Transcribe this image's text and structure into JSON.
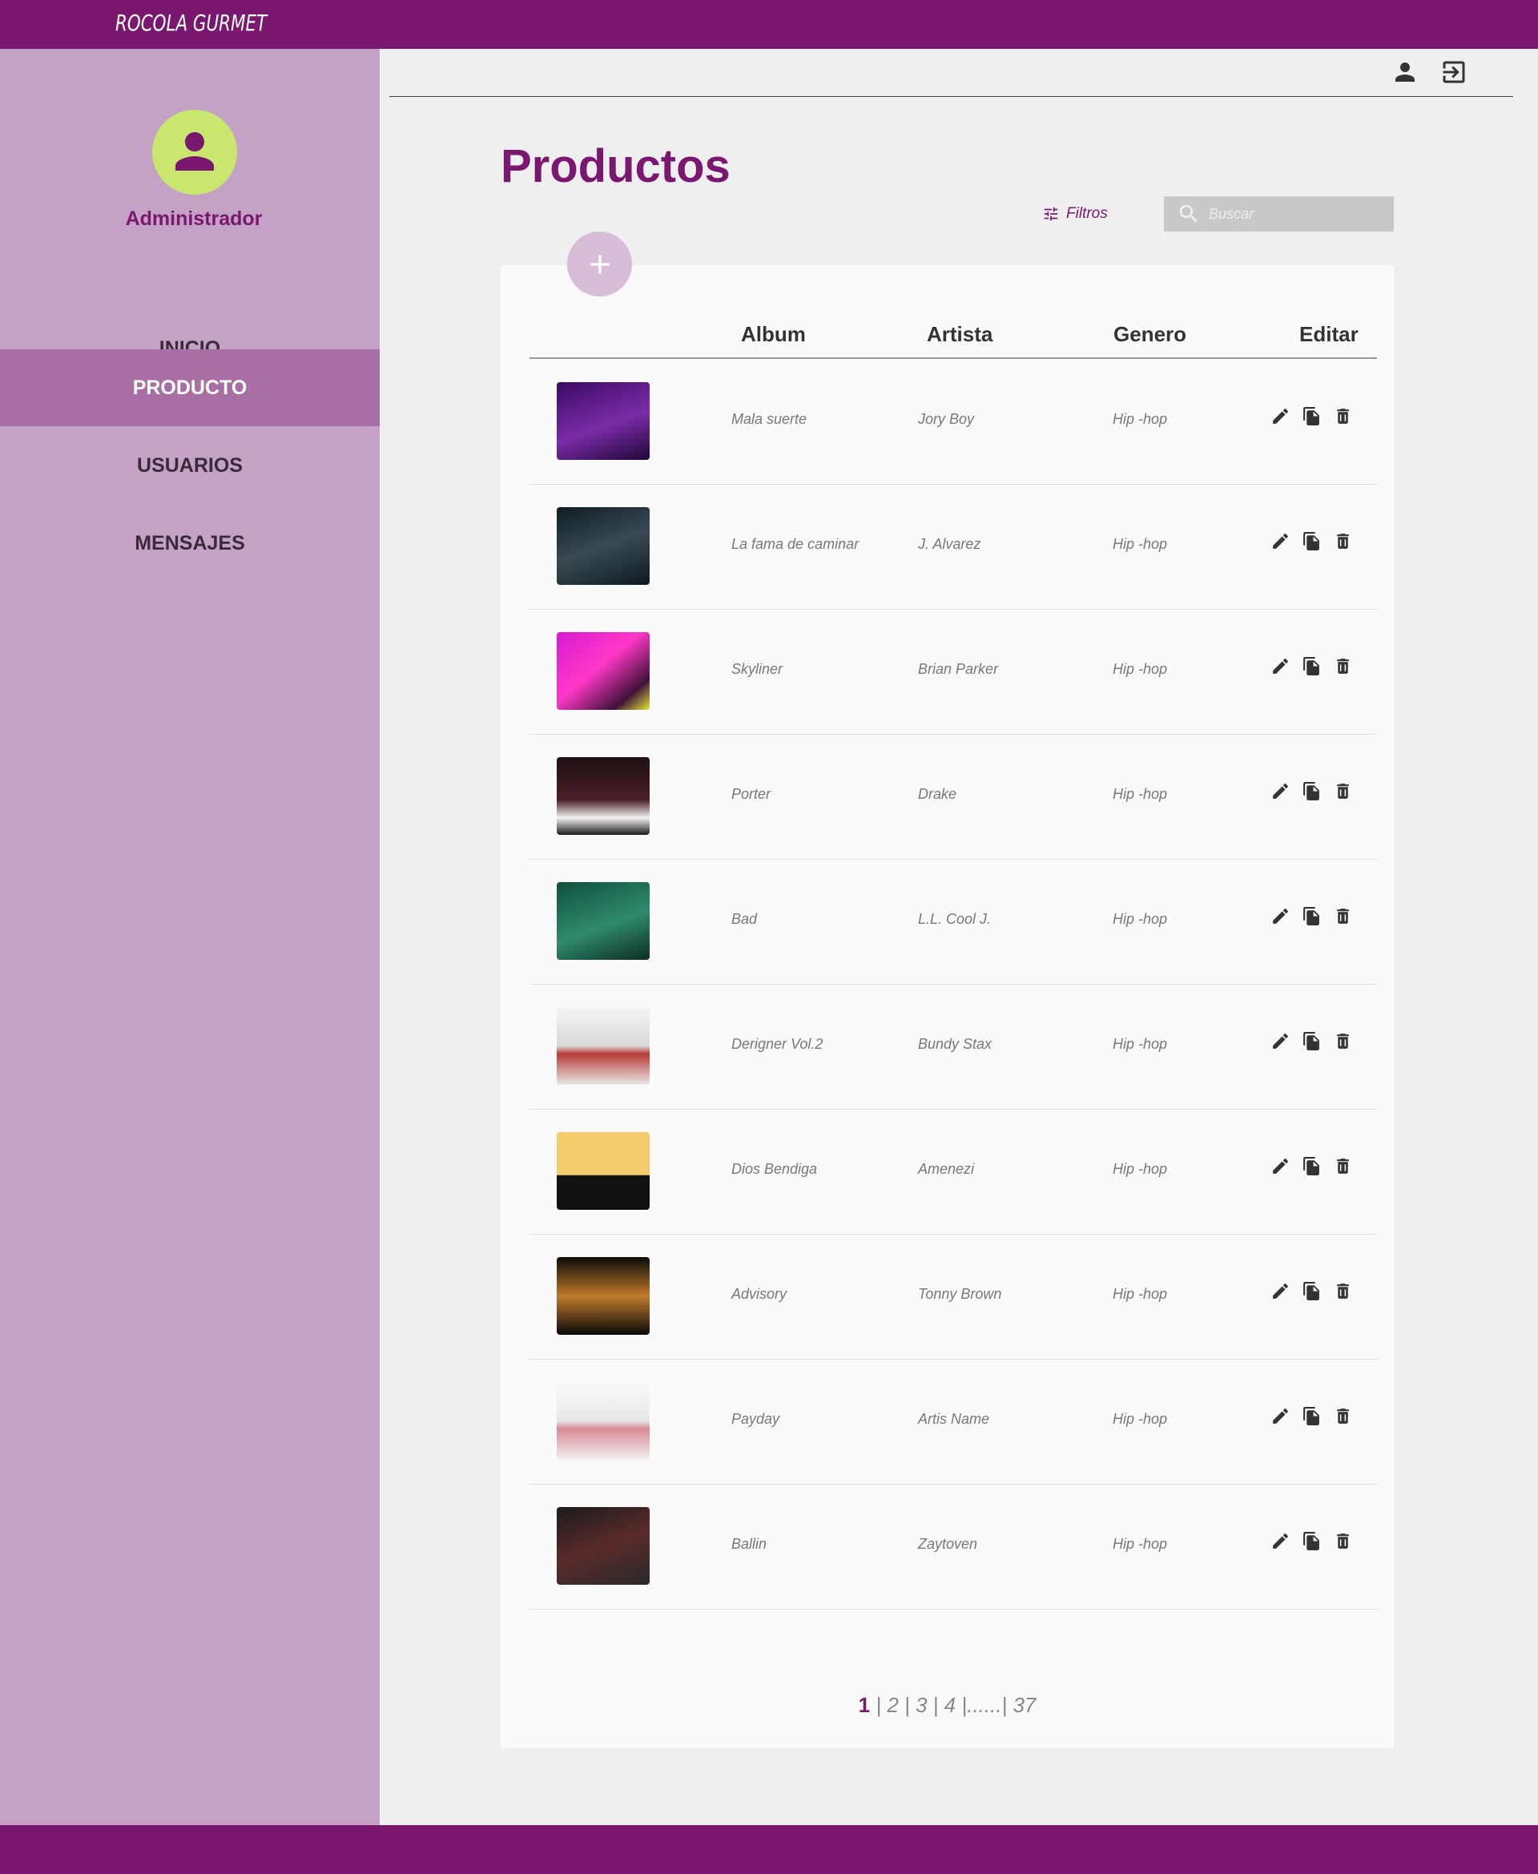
{
  "app": {
    "brand": "ROCOLA GURMET"
  },
  "sidebar": {
    "user_role": "Administrador",
    "items": [
      {
        "label": "INICIO",
        "active": false
      },
      {
        "label": "PRODUCTO",
        "active": true
      },
      {
        "label": "USUARIOS",
        "active": false
      },
      {
        "label": "MENSAJES",
        "active": false
      }
    ]
  },
  "header": {
    "icons": [
      "person-icon",
      "logout-icon"
    ]
  },
  "main": {
    "title": "Productos",
    "filters_label": "Filtros",
    "search": {
      "placeholder": "Buscar",
      "value": ""
    },
    "table": {
      "columns": [
        "Album",
        "Artista",
        "Genero",
        "Editar"
      ],
      "rows": [
        {
          "album": "Mala suerte",
          "artist": "Jory Boy",
          "genre": "Hip -hop"
        },
        {
          "album": "La fama de caminar",
          "artist": "J. Alvarez",
          "genre": "Hip -hop"
        },
        {
          "album": "Skyliner",
          "artist": "Brian Parker",
          "genre": "Hip -hop"
        },
        {
          "album": "Porter",
          "artist": "Drake",
          "genre": "Hip -hop"
        },
        {
          "album": "Bad",
          "artist": "L.L. Cool J.",
          "genre": "Hip -hop"
        },
        {
          "album": "Derigner Vol.2",
          "artist": "Bundy Stax",
          "genre": "Hip -hop"
        },
        {
          "album": "Dios Bendiga",
          "artist": "Amenezi",
          "genre": "Hip -hop"
        },
        {
          "album": "Advisory",
          "artist": "Tonny Brown",
          "genre": "Hip -hop"
        },
        {
          "album": "Payday",
          "artist": "Artis Name",
          "genre": "Hip -hop"
        },
        {
          "album": "Ballin",
          "artist": "Zaytoven",
          "genre": "Hip -hop"
        }
      ]
    },
    "pagination": {
      "pages": [
        "1",
        "2",
        "3",
        "4",
        "......",
        "37"
      ],
      "current": "1"
    }
  },
  "colors": {
    "brand": "#7a176e",
    "sidebar": "#c4a2c5",
    "active_nav": "#a86fa4",
    "avatar": "#c9e76f"
  }
}
